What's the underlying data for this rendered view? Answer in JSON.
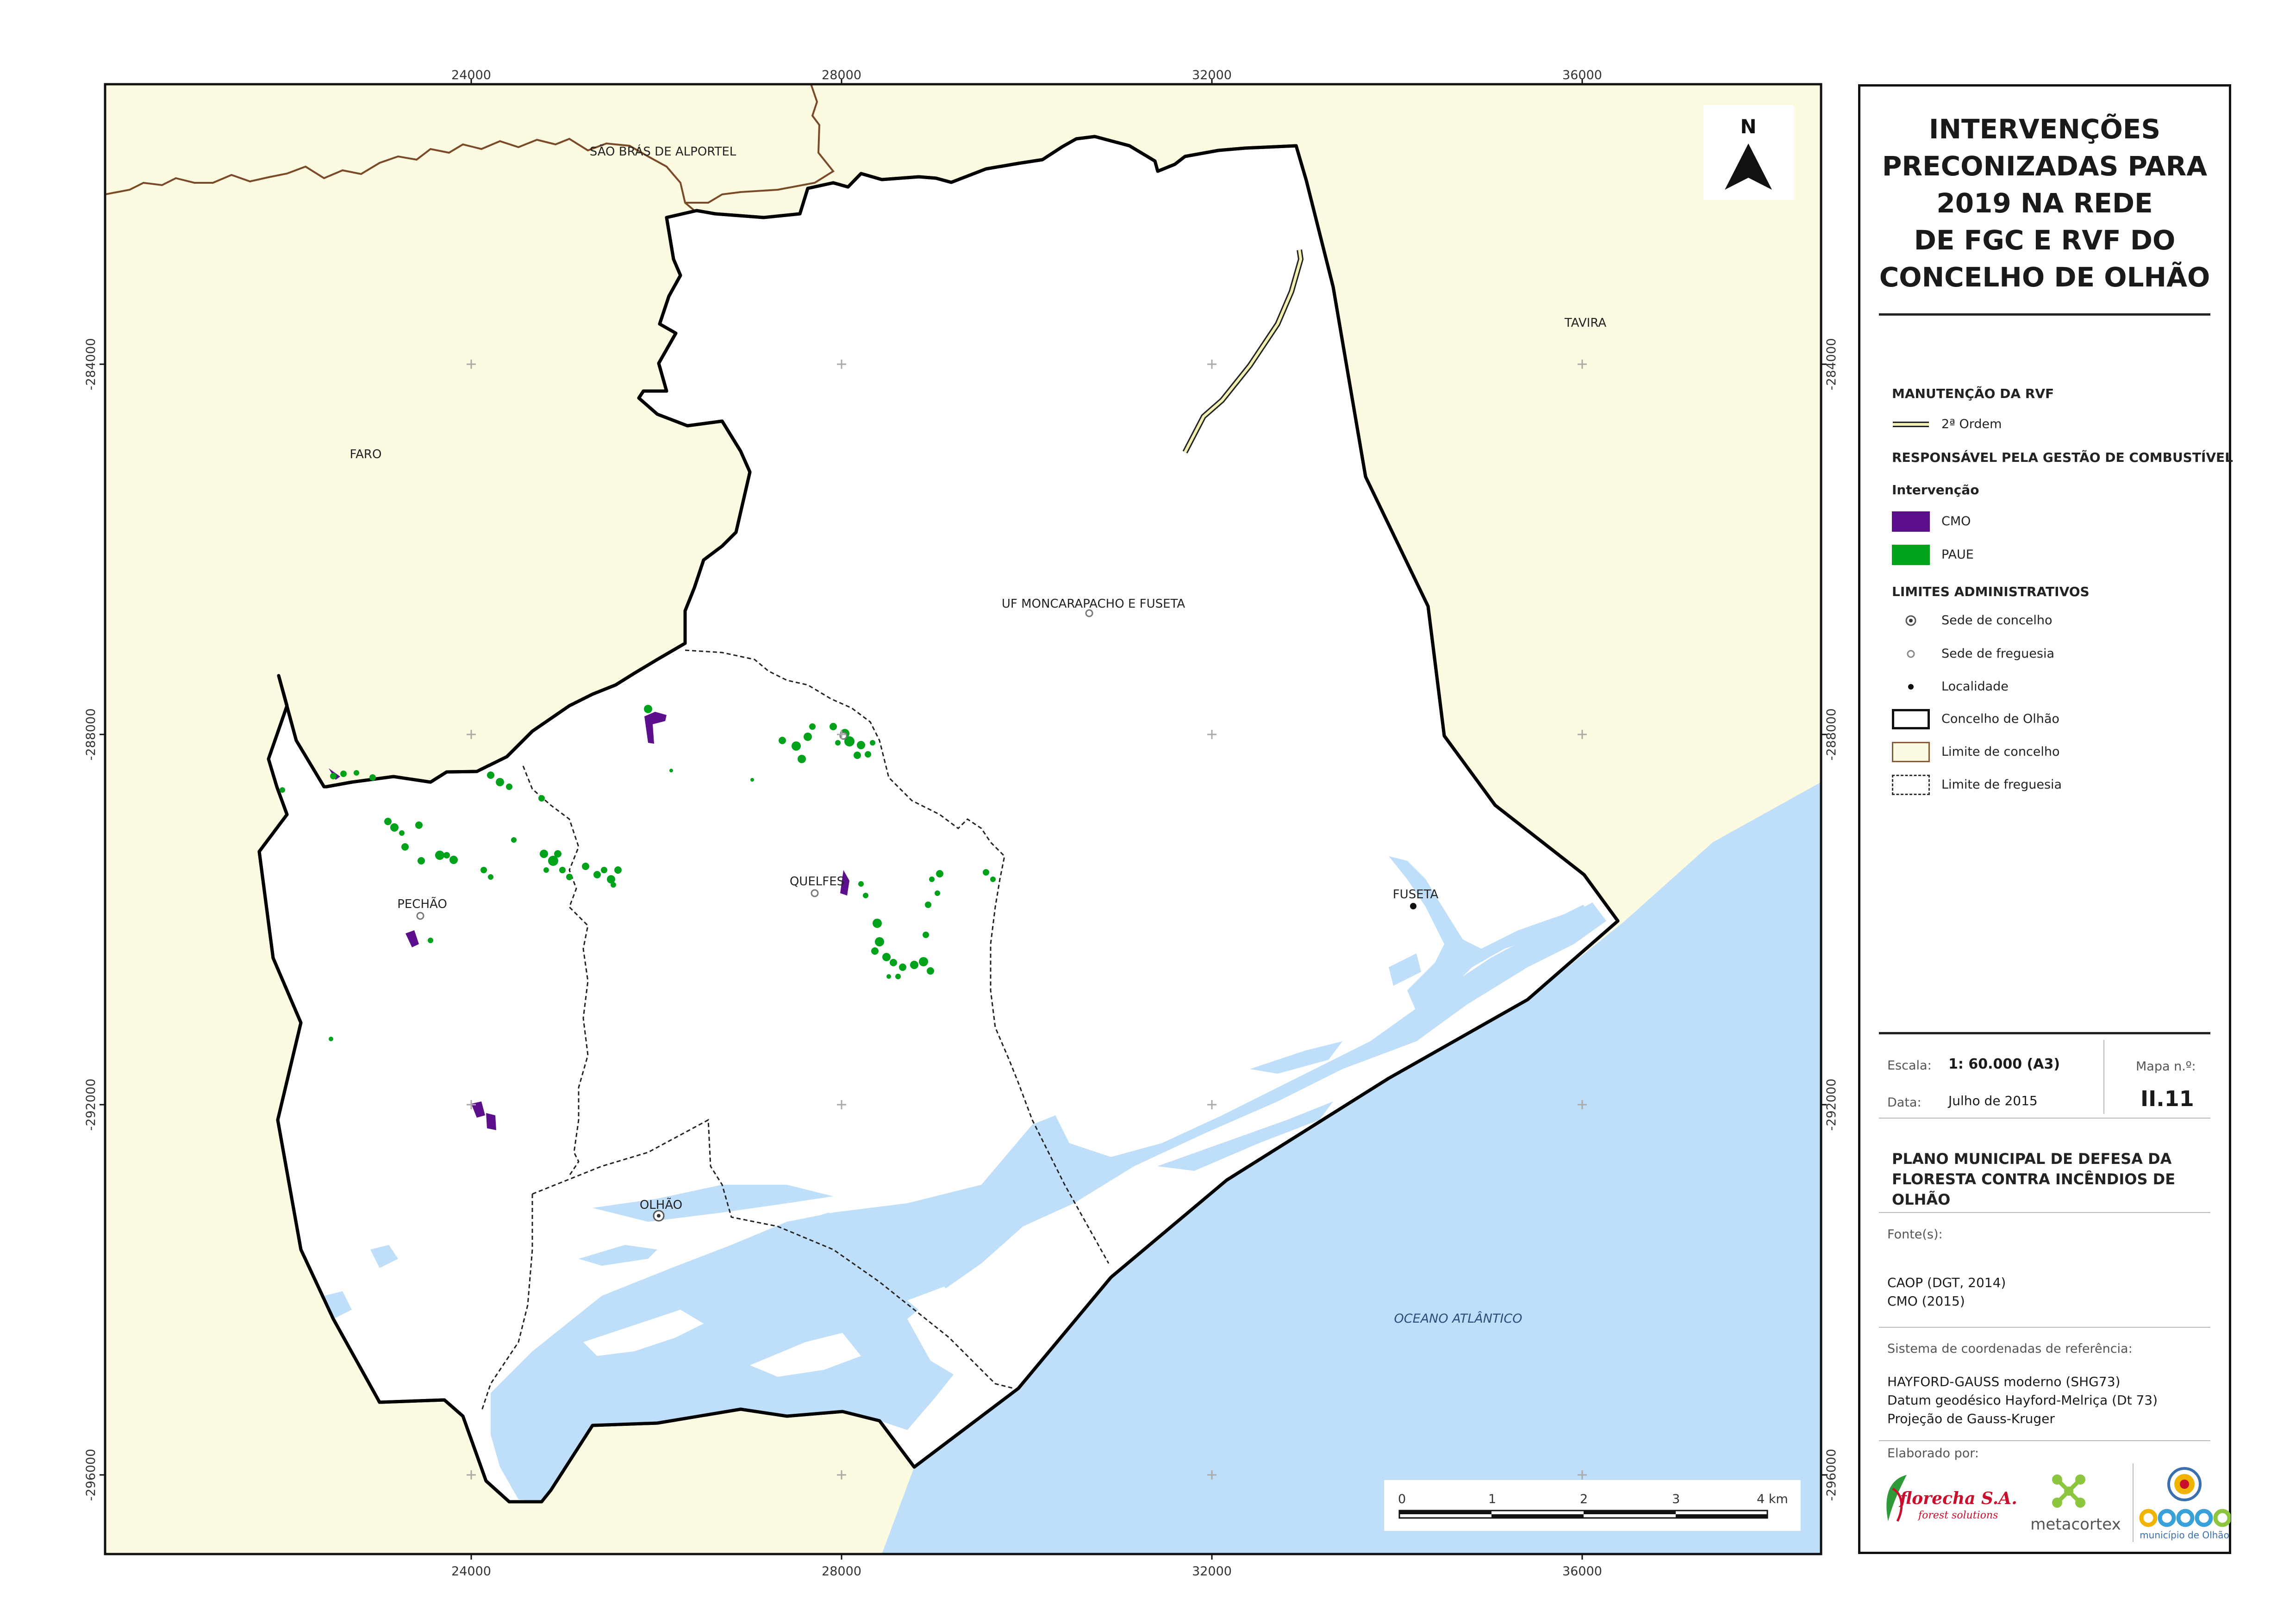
{
  "map": {
    "top_ticks": [
      "24000",
      "28000",
      "32000",
      "36000"
    ],
    "bottom_ticks": [
      "24000",
      "28000",
      "32000",
      "36000"
    ],
    "left_ticks": [
      "-284000",
      "-288000",
      "-292000",
      "-296000"
    ],
    "right_ticks": [
      "-284000",
      "-288000",
      "-292000",
      "-296000"
    ],
    "north_label": "N",
    "places": {
      "sao_bras": "SÃO BRÁS DE ALPORTEL",
      "tavira": "TAVIRA",
      "faro": "FARO",
      "moncarapacho": "UF MONCARAPACHO E FUSETA",
      "pechao": "PECHÃO",
      "quelfes": "QUELFES",
      "fuseta": "FUSETA",
      "olhao": "OLHÃO",
      "ocean": "OCEANO ATLÂNTICO"
    },
    "scalebar": {
      "labels": [
        "0",
        "1",
        "2",
        "3",
        "4 km"
      ]
    },
    "colors": {
      "land_outside": "#fcfae1",
      "sea": "#bedefa",
      "cmo": "#5b0f8c",
      "paue": "#00a21a",
      "rvf_fill": "#f3efb2"
    }
  },
  "legend": {
    "title_lines": [
      "INTERVENÇÕES",
      "PRECONIZADAS PARA",
      "2019 NA REDE",
      "DE FGC E RVF DO",
      "CONCELHO DE OLHÃO"
    ],
    "section_rvf": "MANUTENÇÃO DA RVF",
    "item_rvf": "2ª Ordem",
    "section_resp": "RESPONSÁVEL PELA GESTÃO DE COMBUSTÍVEL",
    "section_intervencao": "Intervenção",
    "item_cmo": "CMO",
    "item_paue": "PAUE",
    "section_limits": "LIMITES ADMINISTRATIVOS",
    "item_sede_concelho": "Sede de concelho",
    "item_sede_freguesia": "Sede de freguesia",
    "item_localidade": "Localidade",
    "item_concelho_olhao": "Concelho de Olhão",
    "item_limite_concelho": "Limite de concelho",
    "item_limite_freguesia": "Limite de freguesia"
  },
  "info": {
    "escala_label": "Escala:",
    "escala_value": "1: 60.000 (A3)",
    "data_label": "Data:",
    "data_value": "Julho de 2015",
    "mapa_label": "Mapa n.º:",
    "mapa_value": "II.11",
    "plan_lines": [
      "PLANO MUNICIPAL DE DEFESA DA",
      "FLORESTA CONTRA INCÊNDIOS DE",
      "OLHÃO"
    ],
    "fontes_label": "Fonte(s):",
    "fontes": [
      "CAOP (DGT, 2014)",
      "CMO (2015)"
    ],
    "sistema_label": "Sistema de coordenadas de referência:",
    "sistema": [
      "HAYFORD-GAUSS moderno (SHG73)",
      "Datum geodésico Hayford-Melriça (Dt 73)",
      "Projeção de Gauss-Kruger"
    ],
    "elaborado_label": "Elaborado por:",
    "logos": {
      "florecha_name": "florecha S.A.",
      "florecha_tag": "forest solutions",
      "metacortex": "metacortex",
      "municipio": "município de Olhão"
    }
  }
}
